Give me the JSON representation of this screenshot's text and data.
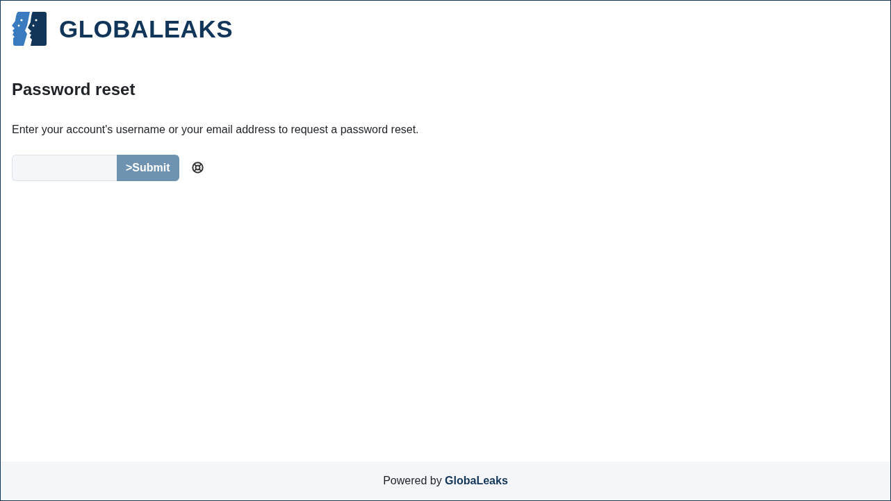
{
  "header": {
    "logo_text": "GLOBALEAKS"
  },
  "page": {
    "title": "Password reset",
    "instructions": "Enter your account's username or your email address to request a password reset.",
    "submit_button": {
      "label": ">Submit",
      "disabled": true
    }
  },
  "footer": {
    "prefix": "Powered by",
    "link": "GlobaLeaks"
  }
}
